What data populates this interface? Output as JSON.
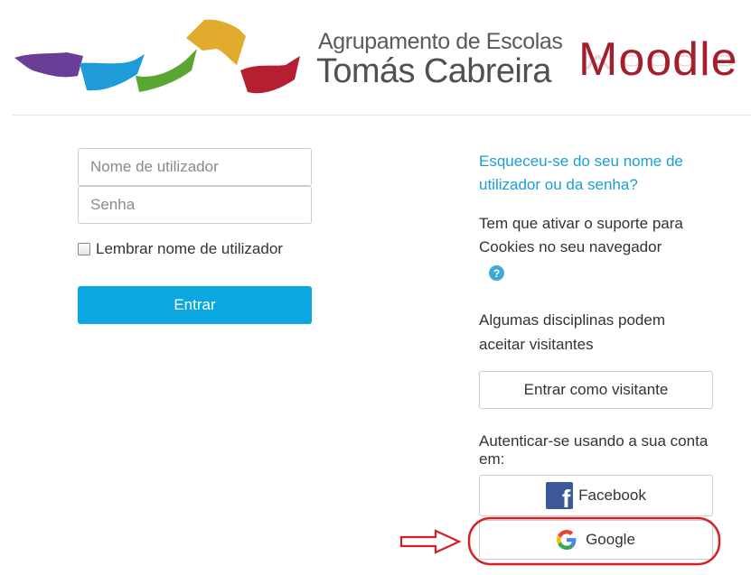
{
  "header": {
    "school_line1": "Agrupamento de Escolas",
    "school_line2": "Tomás Cabreira",
    "brand": "Moodle"
  },
  "login_form": {
    "username_placeholder": "Nome de utilizador",
    "password_placeholder": "Senha",
    "remember_label": "Lembrar nome de utilizador",
    "login_button": "Entrar"
  },
  "side_panel": {
    "forgot_link": "Esqueceu-se do seu nome de utilizador ou da senha?",
    "cookies_text": "Tem que ativar o suporte para Cookies no seu navegador",
    "help_icon": "?",
    "guests_text": "Algumas disciplinas podem aceitar visitantes",
    "guest_button": "Entrar como visitante",
    "auth_text": "Autenticar-se usando a sua conta em:",
    "facebook_button": "Facebook",
    "google_button": "Google"
  },
  "colors": {
    "accent_blue": "#0ba7e0",
    "link_blue": "#1a9ed6",
    "moodle_red": "#a31f2d",
    "annotation_red": "#d61f26",
    "facebook_blue": "#3b5998"
  },
  "icons": {
    "help": "question-circle-icon",
    "facebook": "facebook-icon",
    "google": "google-icon",
    "annotation_arrow": "arrow-right-icon"
  }
}
